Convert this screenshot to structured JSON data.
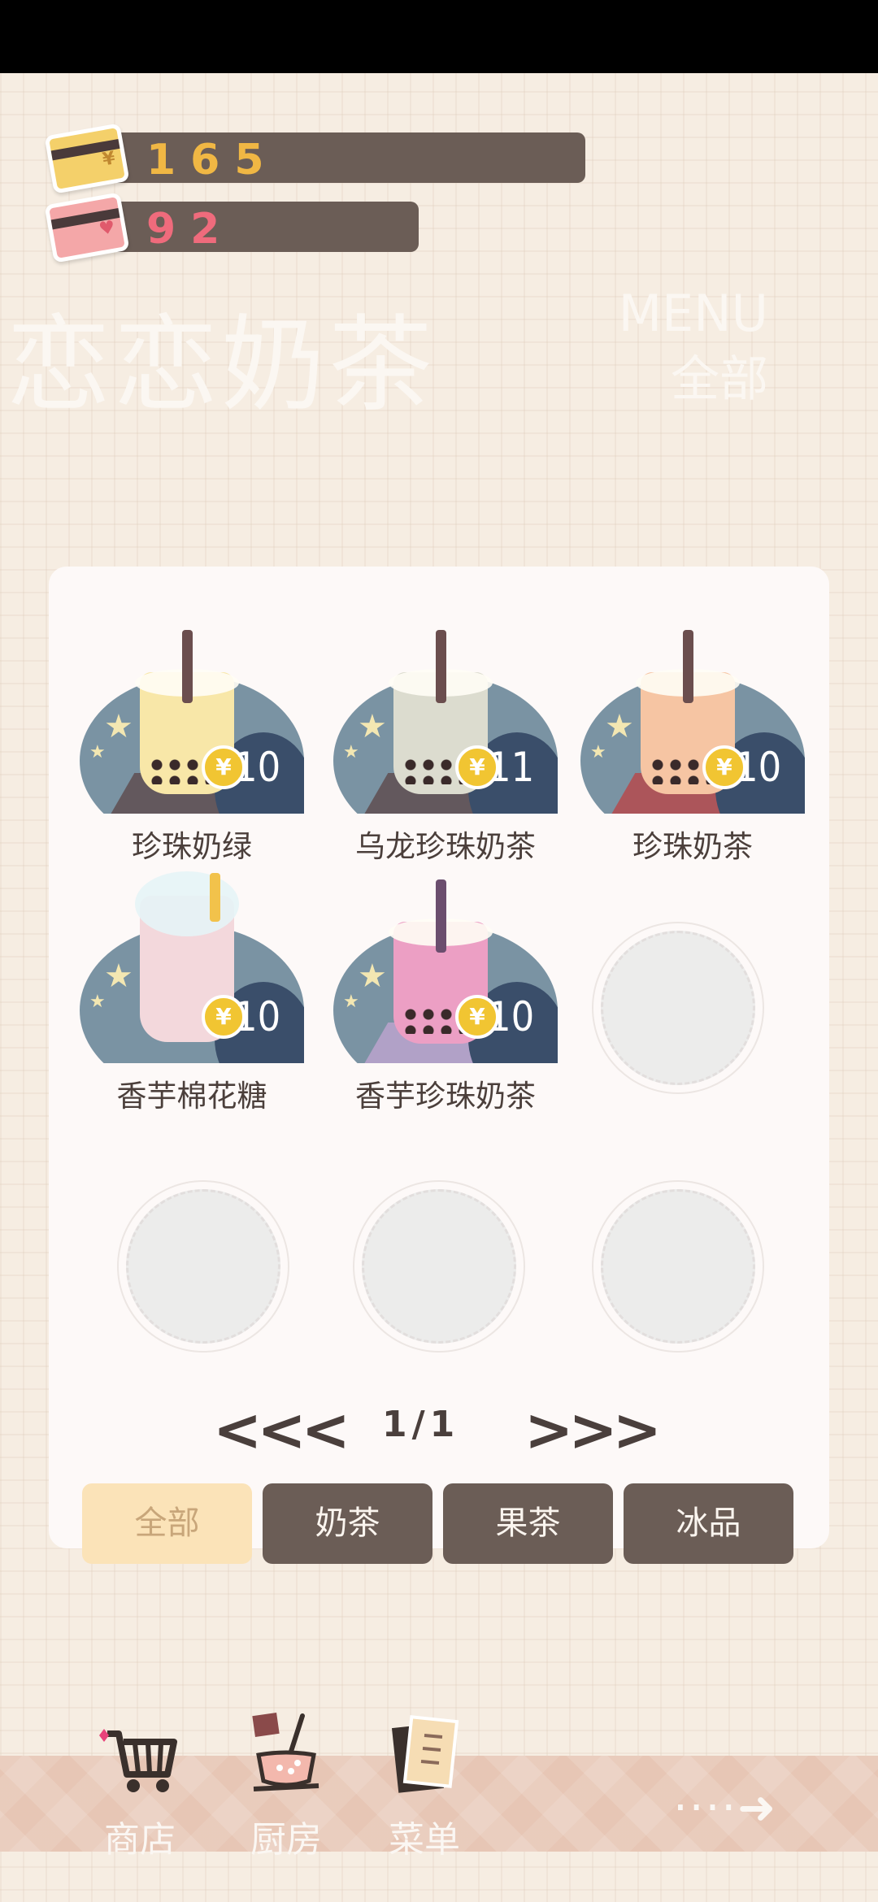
{
  "currency": {
    "gold": "165",
    "hearts": "92",
    "gold_symbol": "¥",
    "heart_symbol": "♥"
  },
  "shop_title": "恋恋奶茶",
  "menu": {
    "label": "MENU",
    "category": "全部"
  },
  "items": [
    {
      "name": "珍珠奶绿",
      "price": "10",
      "coin": "¥",
      "cup_color": "#f8e7a8"
    },
    {
      "name": "乌龙珍珠奶茶",
      "price": "11",
      "coin": "¥",
      "cup_color": "#dcdccf"
    },
    {
      "name": "珍珠奶茶",
      "price": "10",
      "coin": "¥",
      "cup_color": "#f6c5a3"
    },
    {
      "name": "香芋棉花糖",
      "price": "10",
      "coin": "¥",
      "cup_color": "#f3d8dc"
    },
    {
      "name": "香芋珍珠奶茶",
      "price": "10",
      "coin": "¥",
      "cup_color": "#ec9fc4"
    }
  ],
  "pager": {
    "prev": "<<<",
    "next": ">>>",
    "page": "1/1"
  },
  "tabs": [
    "全部",
    "奶茶",
    "果茶",
    "冰品"
  ],
  "nav": {
    "shop": "商店",
    "kitchen": "厨房",
    "menu": "菜单",
    "more": "····➜"
  }
}
